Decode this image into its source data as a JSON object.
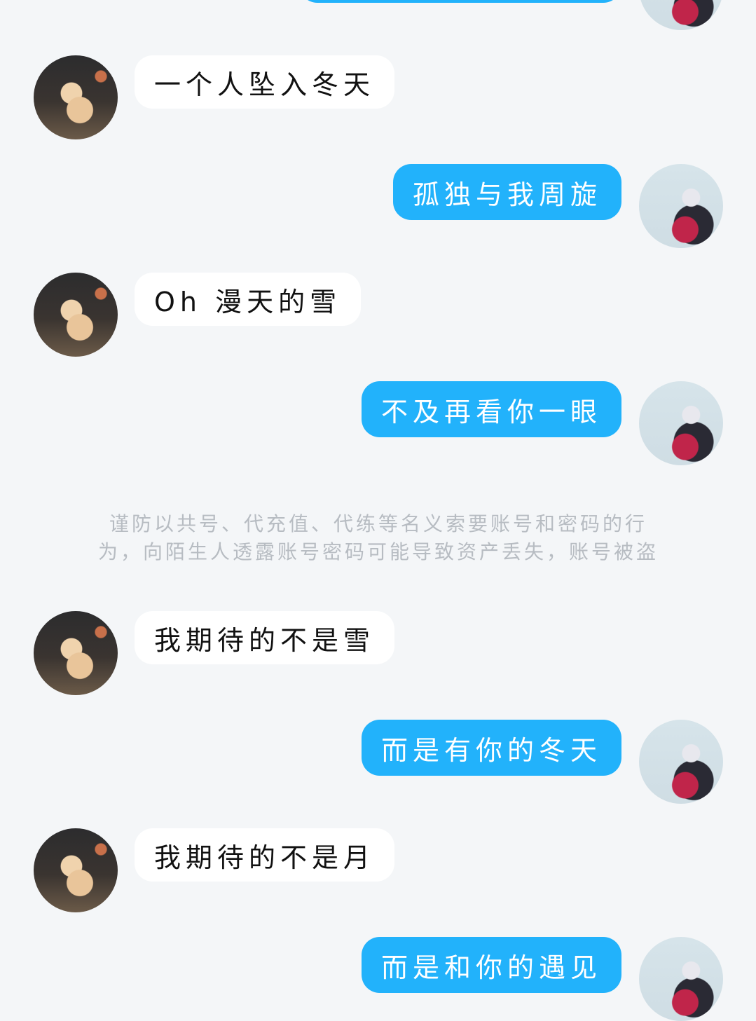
{
  "messages": [
    {
      "side": "right",
      "text": ""
    },
    {
      "side": "left",
      "text": "一个人坠入冬天"
    },
    {
      "side": "right",
      "text": "孤独与我周旋"
    },
    {
      "side": "left",
      "text": "Oh 漫天的雪"
    },
    {
      "side": "right",
      "text": "不及再看你一眼"
    },
    {
      "side": "left",
      "text": "我期待的不是雪"
    },
    {
      "side": "right",
      "text": "而是有你的冬天"
    },
    {
      "side": "left",
      "text": "我期待的不是月"
    },
    {
      "side": "right",
      "text": "而是和你的遇见"
    }
  ],
  "warning": {
    "line1": "谨防以共号、代充值、代练等名义索要账号和密码的行",
    "line2": "为，向陌生人透露账号密码可能导致资产丢失，账号被盗"
  },
  "colors": {
    "background": "#f4f6f8",
    "right_bubble": "#22b2fb",
    "left_bubble": "#ffffff",
    "warning_text": "#b7bcc2"
  }
}
